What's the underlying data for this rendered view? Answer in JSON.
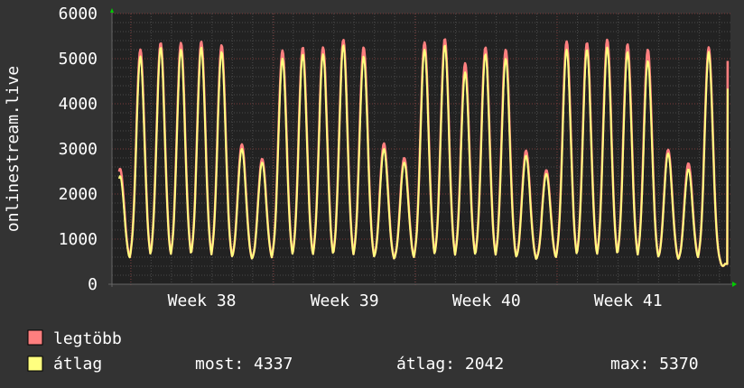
{
  "chart_data": {
    "type": "line",
    "ylabel": "onlinestream.live",
    "ylim": [
      0,
      6000
    ],
    "yticks": [
      0,
      1000,
      2000,
      3000,
      4000,
      5000,
      6000
    ],
    "ytick_labels": [
      "0",
      "1000",
      "2000",
      "3000",
      "4000",
      "5000",
      "6000"
    ],
    "xlim_days": [
      -0.4,
      30.07
    ],
    "weeks": [
      {
        "label": "Week 38",
        "start_day": 0.53
      },
      {
        "label": "Week 39",
        "start_day": 7.56
      },
      {
        "label": "Week 40",
        "start_day": 14.55
      },
      {
        "label": "Week 41",
        "start_day": 21.53
      }
    ],
    "grid": true,
    "trough": 450,
    "series": [
      {
        "name": "legtöbb",
        "color": "#ff7f7f",
        "daily_peaks": [
          2560,
          5200,
          5350,
          5350,
          5380,
          5300,
          3100,
          2780,
          5180,
          5250,
          5250,
          5420,
          5250,
          3120,
          2800,
          5360,
          5440,
          4900,
          5250,
          5200,
          2960,
          2530,
          5380,
          5350,
          5420,
          5320,
          5200,
          2980,
          2680,
          5250
        ],
        "current": 4950
      },
      {
        "name": "átlag",
        "color": "#ffff7f",
        "daily_peaks": [
          2400,
          5050,
          5250,
          5200,
          5250,
          5150,
          3000,
          2700,
          5000,
          5100,
          5100,
          5300,
          5050,
          3000,
          2700,
          5200,
          5300,
          4700,
          5100,
          5000,
          2850,
          2450,
          5200,
          5200,
          5250,
          5150,
          4950,
          2900,
          2550,
          5150
        ],
        "current": 4337
      }
    ],
    "legend": [
      {
        "label": "legtöbb",
        "color": "#ff7f7f"
      },
      {
        "label": "átlag",
        "color": "#ffff7f"
      }
    ],
    "stats": {
      "now": "most: 4337",
      "avg": "átlag: 2042",
      "max": "max: 5370"
    }
  }
}
